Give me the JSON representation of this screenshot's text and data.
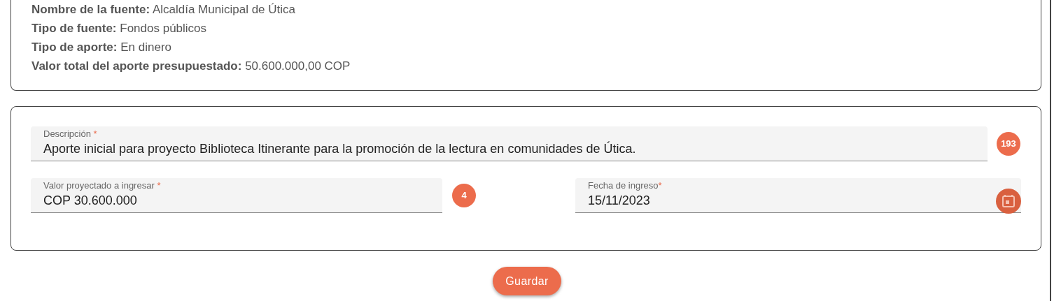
{
  "source_info": [
    {
      "label": "Nombre de la fuente:",
      "value": "Alcaldía Municipal de Útica"
    },
    {
      "label": "Tipo de fuente:",
      "value": "Fondos públicos"
    },
    {
      "label": "Tipo de aporte:",
      "value": "En dinero"
    },
    {
      "label": "Valor total del aporte presupuestado:",
      "value": "50.600.000,00 COP"
    }
  ],
  "form": {
    "description": {
      "label": "Descripción",
      "required_mark": "*",
      "value": "Aporte inicial para proyecto Biblioteca Itinerante para la promoción de la lectura en comunidades de Útica.",
      "counter": "193"
    },
    "projected_value": {
      "label": "Valor proyectado a ingresar",
      "required_mark": "*",
      "value": "COP 30.600.000",
      "counter": "4"
    },
    "date": {
      "label": "Fecha de ingreso",
      "required_mark": "*",
      "value": "15/11/2023"
    }
  },
  "save_button": "Guardar"
}
